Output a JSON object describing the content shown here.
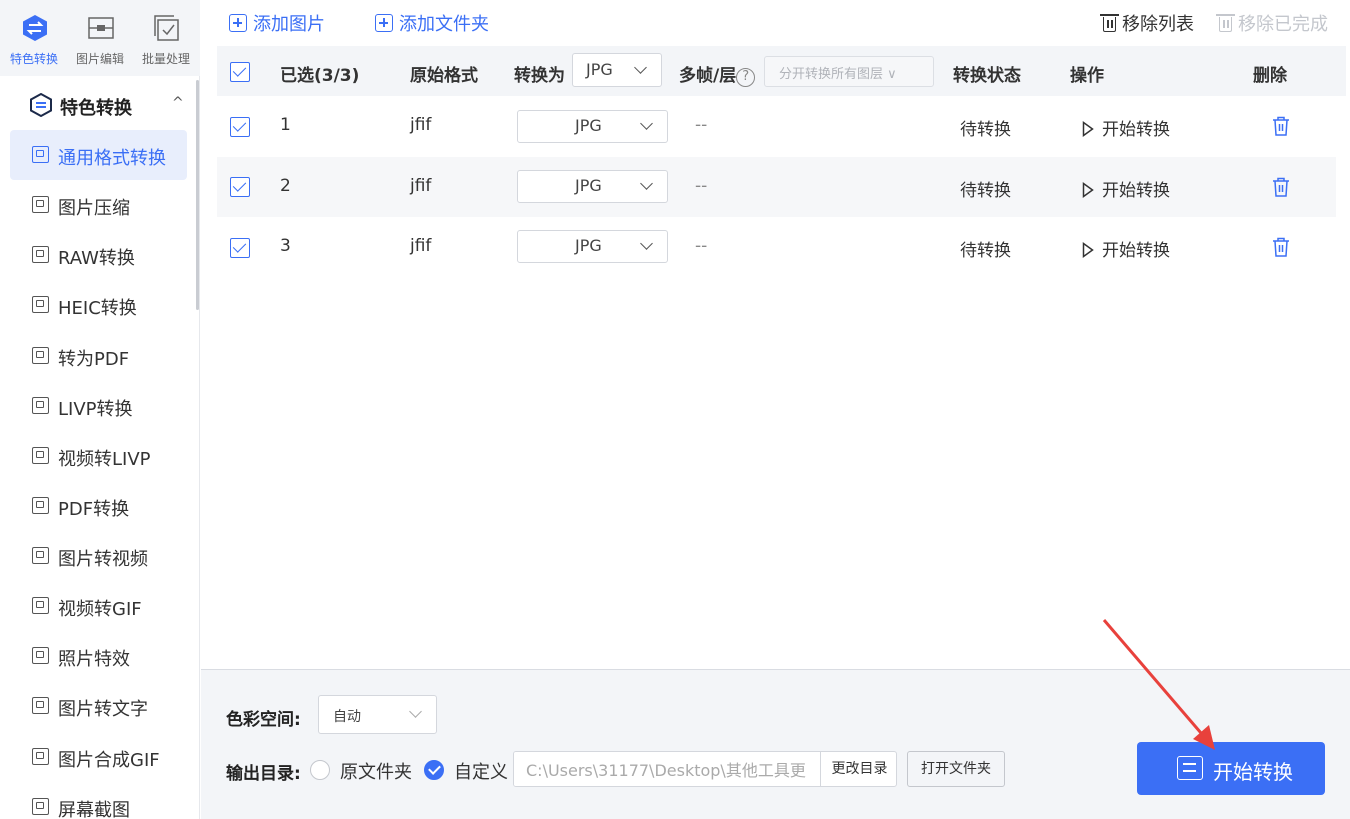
{
  "accent_color": "#3b6ff5",
  "top_nav": [
    {
      "label": "特色转换",
      "icon": "convert-hex-icon",
      "active": true
    },
    {
      "label": "图片编辑",
      "icon": "image-edit-icon",
      "active": false
    },
    {
      "label": "批量处理",
      "icon": "batch-check-icon",
      "active": false
    }
  ],
  "sidebar": {
    "section_title": "特色转换",
    "section_caret": "^",
    "items": [
      {
        "label": "通用格式转换",
        "active": true
      },
      {
        "label": "图片压缩"
      },
      {
        "label": "RAW转换"
      },
      {
        "label": "HEIC转换"
      },
      {
        "label": "转为PDF"
      },
      {
        "label": "LIVP转换"
      },
      {
        "label": "视频转LIVP"
      },
      {
        "label": "PDF转换"
      },
      {
        "label": "图片转视频"
      },
      {
        "label": "视频转GIF"
      },
      {
        "label": "照片特效"
      },
      {
        "label": "图片转文字"
      },
      {
        "label": "图片合成GIF"
      },
      {
        "label": "屏幕截图"
      }
    ]
  },
  "toolbar": {
    "add_images": "添加图片",
    "add_folder": "添加文件夹",
    "remove_list": "移除列表",
    "remove_done": "移除已完成"
  },
  "table": {
    "headers": {
      "selected": "已选(3/3)",
      "original_format": "原始格式",
      "convert_to": "转换为",
      "convert_to_value": "JPG",
      "multi_frame": "多帧/层",
      "help_glyph": "?",
      "layer_option": "分开转换所有图层 ∨",
      "status": "转换状态",
      "action": "操作",
      "delete": "删除"
    },
    "rows": [
      {
        "index": "1",
        "format": "jfif",
        "target": "JPG",
        "frames": "--",
        "status": "待转换",
        "action": "开始转换"
      },
      {
        "index": "2",
        "format": "jfif",
        "target": "JPG",
        "frames": "--",
        "status": "待转换",
        "action": "开始转换"
      },
      {
        "index": "3",
        "format": "jfif",
        "target": "JPG",
        "frames": "--",
        "status": "待转换",
        "action": "开始转换"
      }
    ]
  },
  "bottom": {
    "color_space_label": "色彩空间:",
    "color_space_value": "自动",
    "output_dir_label": "输出目录:",
    "option_original": "原文件夹",
    "option_custom": "自定义",
    "path_value": "C:\\Users\\31177\\Desktop\\其他工具更",
    "change_dir": "更改目录",
    "open_folder": "打开文件夹",
    "start_button": "开始转换"
  }
}
